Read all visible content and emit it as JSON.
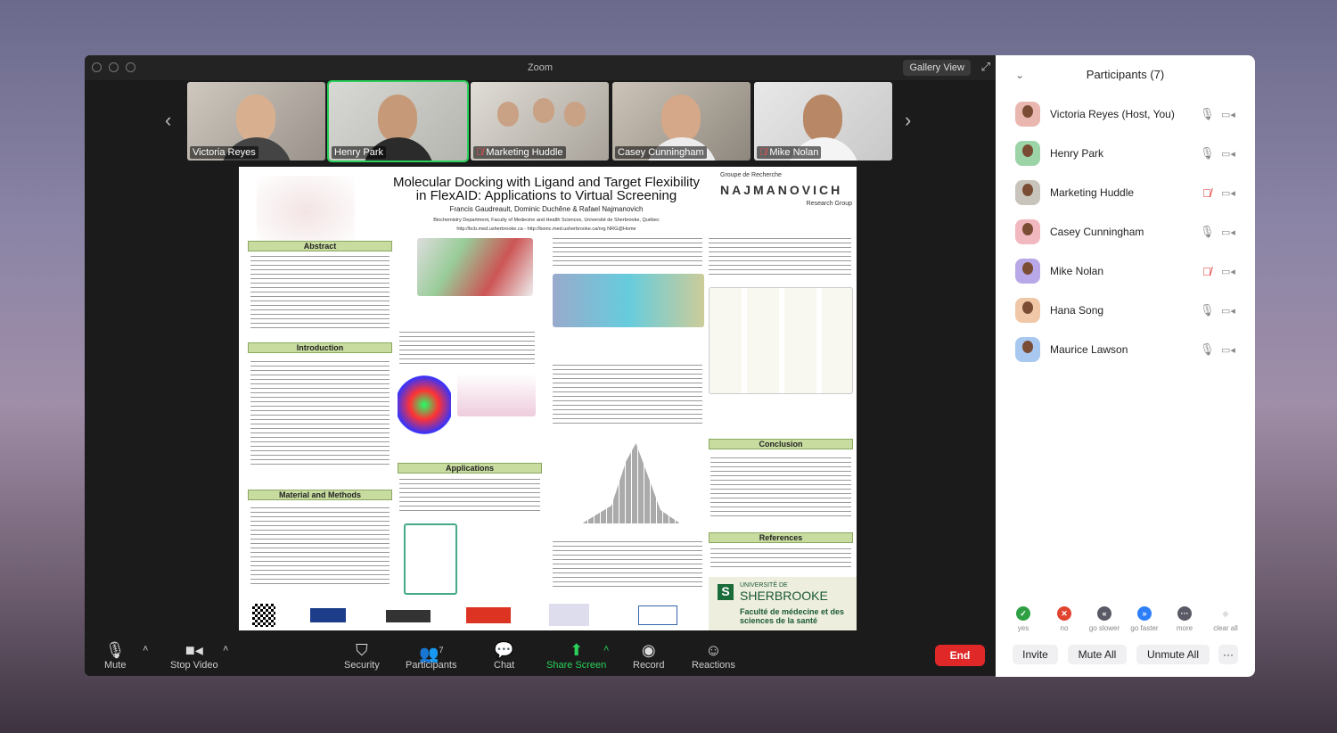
{
  "window": {
    "title": "Zoom",
    "view_button": "Gallery View"
  },
  "thumbnails": [
    {
      "name": "Victoria Reyes",
      "muted": false,
      "active": false
    },
    {
      "name": "Henry Park",
      "muted": false,
      "active": true
    },
    {
      "name": "Marketing Huddle",
      "muted": true,
      "active": false
    },
    {
      "name": "Casey Cunningham",
      "muted": false,
      "active": false
    },
    {
      "name": "Mike Nolan",
      "muted": true,
      "active": false
    }
  ],
  "poster": {
    "title_line1": "Molecular Docking with Ligand and Target Flexibility",
    "title_line2": "in FlexAID: Applications to Virtual Screening",
    "authors": "Francis Gaudreault, Dominic Duchêne & Rafael Najmanovich",
    "affiliation": "Biochemistry Department, Faculty of Medecine and Health Sciences, Université de Sherbrooke, Québec",
    "urls": "http://bcb.med.usherbrooke.ca - http://boinc.med.usherbrooke.ca/nrg   NRG@Home",
    "group": "Groupe de Recherche",
    "group_name": "NAJMANOVICH",
    "group_sub": "Research Group",
    "sections": {
      "abstract": "Abstract",
      "introduction": "Introduction",
      "material": "Material and Methods",
      "applications": "Applications",
      "conclusion": "Conclusion",
      "references": "References"
    },
    "university": "UNIVERSITÉ DE",
    "university_name": "SHERBROOKE",
    "faculty": "Faculté de médecine et des sciences de la santé"
  },
  "toolbar": {
    "mute": "Mute",
    "stop_video": "Stop Video",
    "security": "Security",
    "participants": "Participants",
    "participants_count": "7",
    "chat": "Chat",
    "share_screen": "Share Screen",
    "record": "Record",
    "reactions": "Reactions",
    "end": "End"
  },
  "panel": {
    "title": "Participants (7)",
    "participants": [
      {
        "name": "Victoria Reyes (Host, You)",
        "muted": false
      },
      {
        "name": "Henry Park",
        "muted": false
      },
      {
        "name": "Marketing Huddle",
        "muted": true
      },
      {
        "name": "Casey Cunningham",
        "muted": false
      },
      {
        "name": "Mike Nolan",
        "muted": true
      },
      {
        "name": "Hana Song",
        "muted": false
      },
      {
        "name": "Maurice Lawson",
        "muted": false
      }
    ],
    "feedback": [
      {
        "label": "yes",
        "color": "#2ea043",
        "icon": "✓"
      },
      {
        "label": "no",
        "color": "#e0432e",
        "icon": "✕"
      },
      {
        "label": "go slower",
        "color": "#5a5a66",
        "icon": "«"
      },
      {
        "label": "go faster",
        "color": "#2d7ff9",
        "icon": "»"
      },
      {
        "label": "more",
        "color": "#5a5a66",
        "icon": "···"
      },
      {
        "label": "clear all",
        "color": "#e6e6e6",
        "icon": "◆"
      }
    ],
    "invite": "Invite",
    "mute_all": "Mute All",
    "unmute_all": "Unmute All",
    "more": "···"
  }
}
